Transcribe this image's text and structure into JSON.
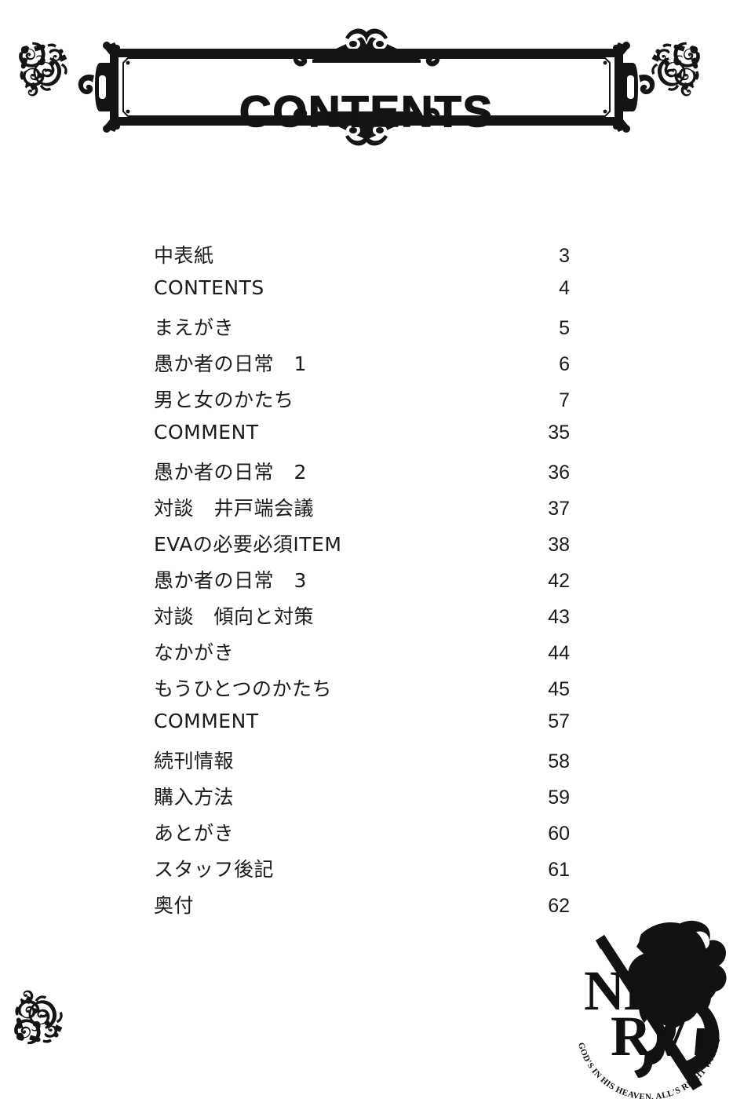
{
  "page": {
    "background_color": "#ffffff",
    "ink_color": "#111111"
  },
  "header": {
    "title": "CONTENTS",
    "ornament_name": "victorian-filigree-corner"
  },
  "toc": {
    "entries": [
      {
        "title": "中表紙",
        "page": "3"
      },
      {
        "title": "CONTENTS",
        "page": "4"
      },
      {
        "title": "まえがき",
        "page": "5"
      },
      {
        "title": "愚か者の日常　1",
        "page": "6"
      },
      {
        "title": "男と女のかたち",
        "page": "7"
      },
      {
        "title": "COMMENT",
        "page": "35"
      },
      {
        "title": "愚か者の日常　2",
        "page": "36"
      },
      {
        "title": "対談　井戸端会議",
        "page": "37"
      },
      {
        "title": "EVAの必要必須ITEM",
        "page": "38"
      },
      {
        "title": "愚か者の日常　3",
        "page": "42"
      },
      {
        "title": "対談　傾向と対策",
        "page": "43"
      },
      {
        "title": "なかがき",
        "page": "44"
      },
      {
        "title": "もうひとつのかたち",
        "page": "45"
      },
      {
        "title": "COMMENT",
        "page": "57"
      },
      {
        "title": "続刊情報",
        "page": "58"
      },
      {
        "title": "購入方法",
        "page": "59"
      },
      {
        "title": "あとがき",
        "page": "60"
      },
      {
        "title": "スタッフ後記",
        "page": "61"
      },
      {
        "title": "奥付",
        "page": "62"
      }
    ]
  },
  "logo": {
    "name": "NERV",
    "line1": "NE",
    "line2": "RV",
    "motto": "GOD'S IN HIS HEAVEN. ALL'S RIGHT WITH THE WORLD.",
    "emblem": "fig-leaf"
  }
}
